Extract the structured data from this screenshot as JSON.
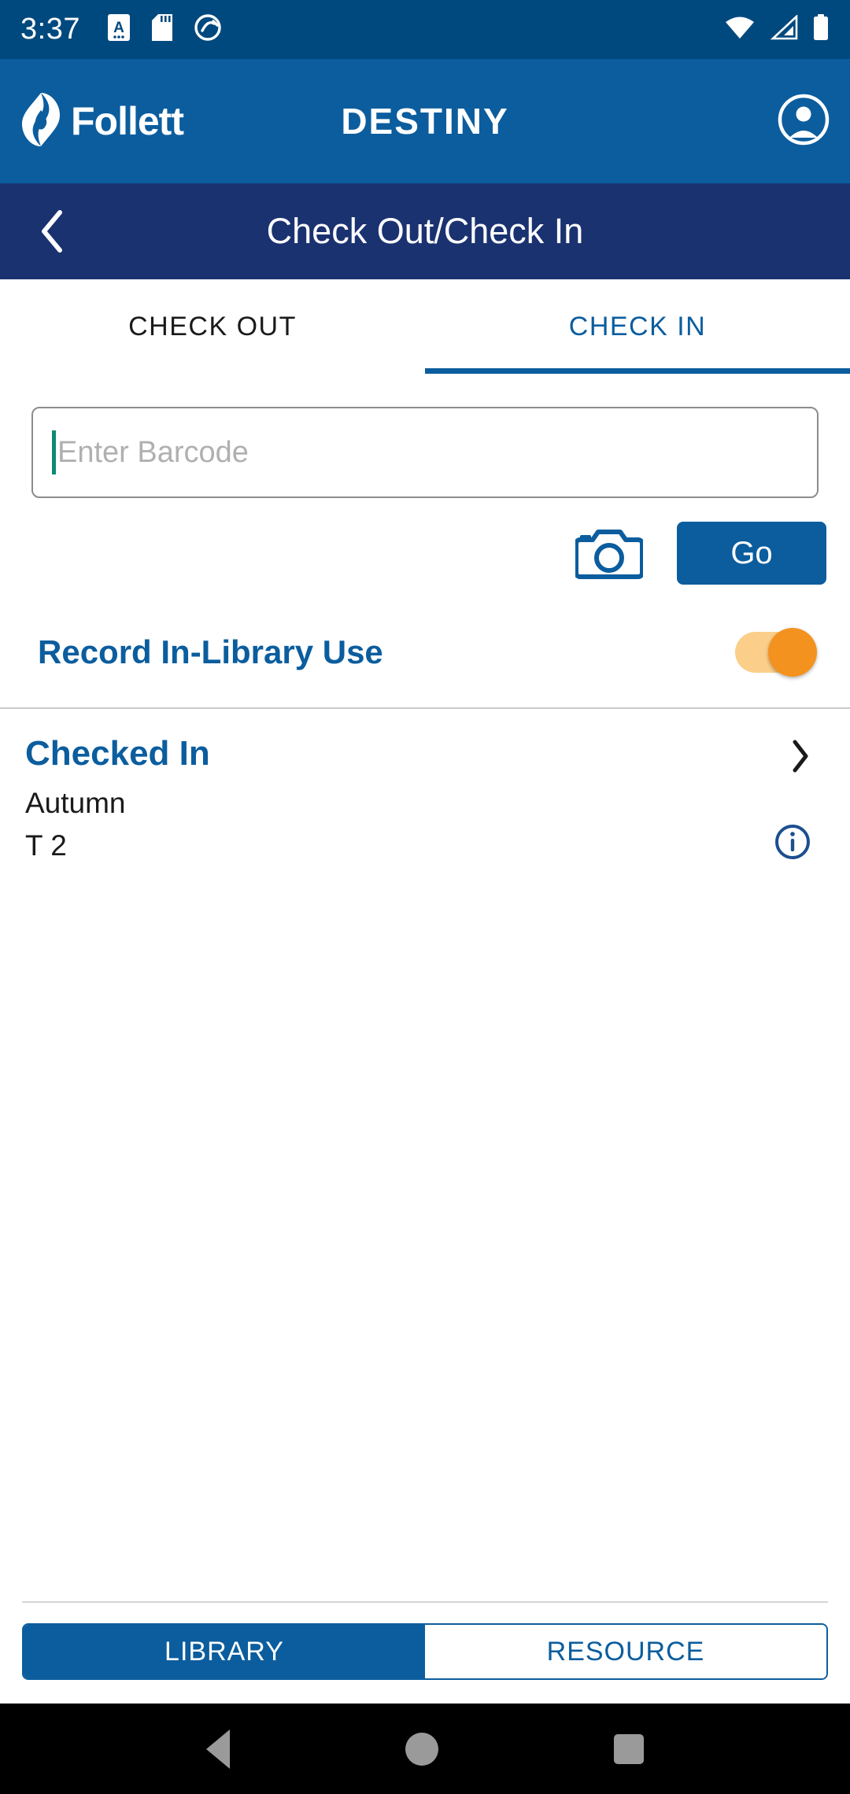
{
  "status_bar": {
    "time": "3:37",
    "left_icons": [
      "document-a-icon",
      "sd-card-icon",
      "circle-slash-icon"
    ],
    "right_icons": [
      "wifi-icon",
      "cell-signal-icon",
      "battery-icon"
    ],
    "background_color": "#00497e"
  },
  "brand_header": {
    "logo_text": "Follett",
    "logo_mark": "follett-flame-icon",
    "title": "DESTINY",
    "account_icon": "account-circle-icon",
    "background_color": "#0b5d9e"
  },
  "sub_header": {
    "back_icon": "chevron-left-icon",
    "title": "Check Out/Check In",
    "background_color": "#1b3270"
  },
  "tabs": [
    {
      "label": "CHECK OUT",
      "active": false
    },
    {
      "label": "CHECK IN",
      "active": true
    }
  ],
  "barcode": {
    "value": "",
    "placeholder": "Enter Barcode",
    "caret_color": "#0e8a74"
  },
  "actions": {
    "camera_icon": "camera-icon",
    "go_label": "Go",
    "go_color": "#0b5d9e"
  },
  "in_library_use": {
    "label": "Record In-Library Use",
    "enabled": true,
    "thumb_color": "#f4921f",
    "track_color": "#fbcf8a"
  },
  "result": {
    "title": "Checked In",
    "lines": [
      "Autumn",
      "T 2"
    ],
    "chevron_icon": "chevron-right-icon",
    "info_icon": "info-circle-icon",
    "title_color": "#0b5d9e"
  },
  "bottom_segmented": [
    {
      "label": "LIBRARY",
      "selected": true
    },
    {
      "label": "RESOURCE",
      "selected": false
    }
  ],
  "android_nav": {
    "back_icon": "nav-back-triangle-icon",
    "home_icon": "nav-home-circle-icon",
    "recents_icon": "nav-recents-square-icon"
  }
}
